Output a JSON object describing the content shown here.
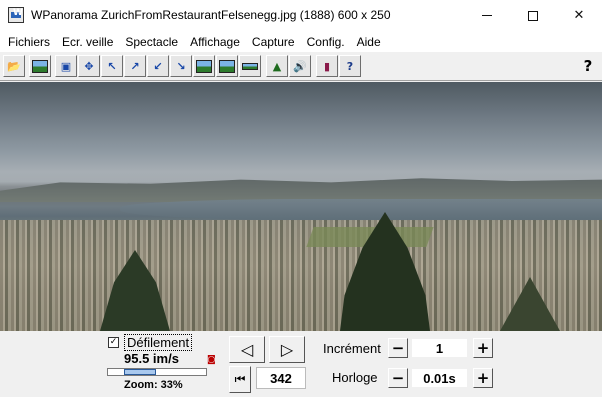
{
  "window": {
    "app_name": "WPanorama",
    "title": "WPanorama  ZurichFromRestaurantFelsenegg.jpg   (1888) 600 x 250"
  },
  "menu": [
    {
      "label": "Fichiers"
    },
    {
      "label": "Ecr. veille"
    },
    {
      "label": "Spectacle"
    },
    {
      "label": "Affichage"
    },
    {
      "label": "Capture"
    },
    {
      "label": "Config."
    },
    {
      "label": "Aide"
    }
  ],
  "toolbar": {
    "icons": [
      "open-folder-icon",
      "image-icon",
      "fit-icon",
      "move-all-icon",
      "arrow-nw-icon",
      "arrow-ne-icon",
      "arrow-sw-icon",
      "arrow-se-icon",
      "panorama-view-icon",
      "landscape-icon",
      "strip-icon",
      "tree-icon",
      "sound-icon",
      "book-icon",
      "help-image-icon"
    ],
    "help_label": "?"
  },
  "controls": {
    "scroll_label": "Défilement",
    "scroll_checked": true,
    "speed": "95.5 im/s",
    "zoom": "Zoom: 33%",
    "zoom_value": 33,
    "frame_number": "342",
    "increment_label": "Incrément",
    "increment_value": "1",
    "clock_label": "Horloge",
    "clock_value": "0.01s"
  }
}
